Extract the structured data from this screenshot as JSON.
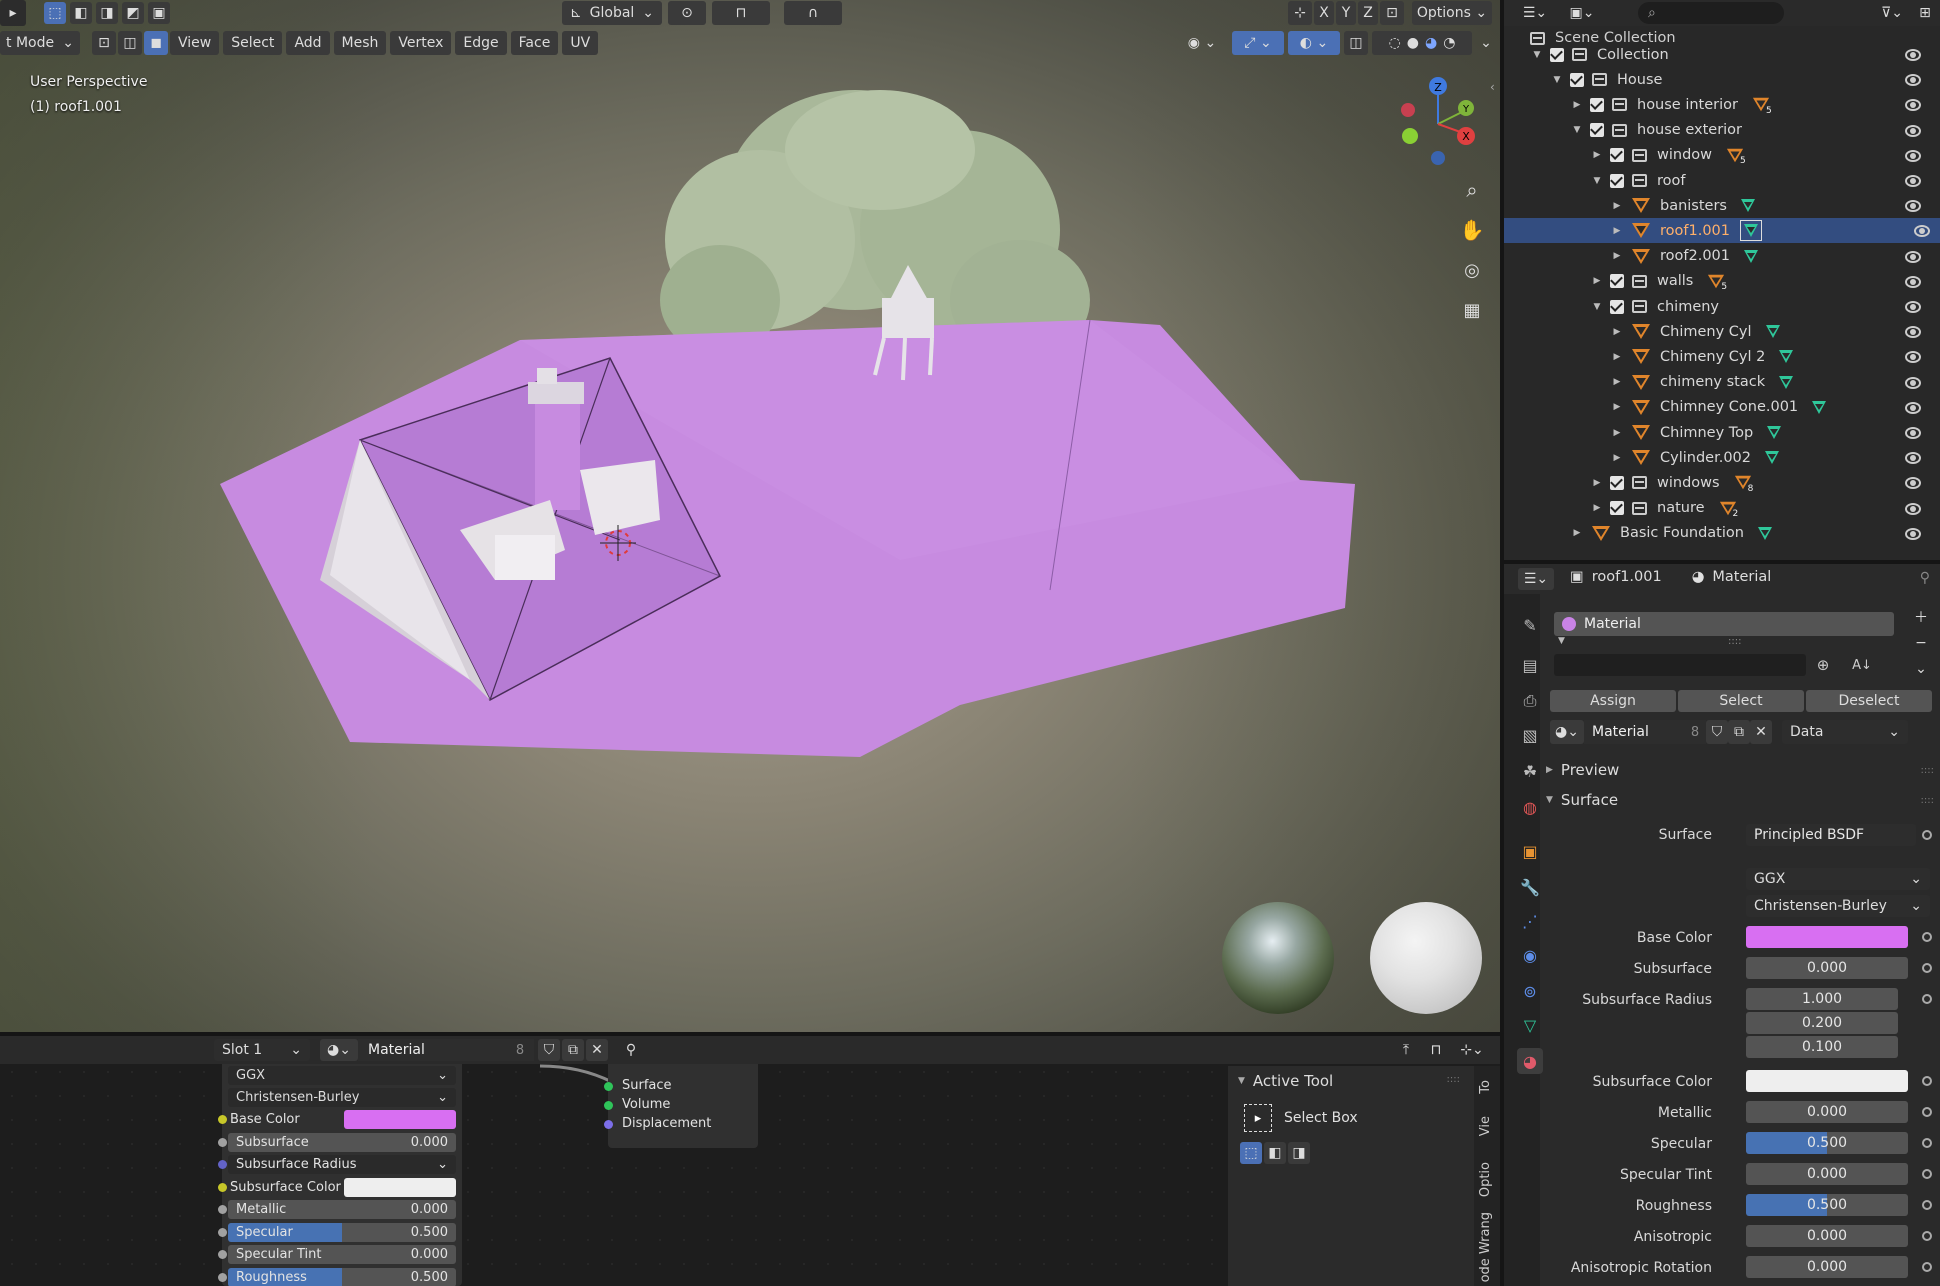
{
  "viewport": {
    "mode_label": "t Mode",
    "menus": [
      "View",
      "Select",
      "Add",
      "Mesh",
      "Vertex",
      "Edge",
      "Face",
      "UV"
    ],
    "transform_orientation": "Global",
    "axis_labels": [
      "X",
      "Y",
      "Z"
    ],
    "options_label": "Options",
    "overlay_title": "User Perspective",
    "overlay_object": "(1) roof1.001",
    "gizmo_axes": {
      "z": "Z",
      "y": "Y",
      "x": "X"
    }
  },
  "outliner": {
    "root": "Scene Collection",
    "rows": [
      {
        "label": "Collection",
        "kind": "collection",
        "depth": 0,
        "expanded": true,
        "check": true
      },
      {
        "label": "House",
        "kind": "collection",
        "depth": 1,
        "expanded": true,
        "check": true
      },
      {
        "label": "house interior",
        "kind": "collection",
        "depth": 2,
        "expanded": false,
        "check": true,
        "badge": "5"
      },
      {
        "label": "house exterior",
        "kind": "collection",
        "depth": 2,
        "expanded": true,
        "check": true
      },
      {
        "label": "window",
        "kind": "collection",
        "depth": 3,
        "expanded": false,
        "check": true,
        "badge": "5"
      },
      {
        "label": "roof",
        "kind": "collection",
        "depth": 3,
        "expanded": true,
        "check": true
      },
      {
        "label": "banisters",
        "kind": "mesh",
        "depth": 4,
        "expanded": false
      },
      {
        "label": "roof1.001",
        "kind": "mesh",
        "depth": 4,
        "expanded": false,
        "selected": true
      },
      {
        "label": "roof2.001",
        "kind": "mesh",
        "depth": 4,
        "expanded": false
      },
      {
        "label": "walls",
        "kind": "collection",
        "depth": 3,
        "expanded": false,
        "check": true,
        "badge": "5"
      },
      {
        "label": "chimeny",
        "kind": "collection",
        "depth": 3,
        "expanded": true,
        "check": true
      },
      {
        "label": "Chimeny Cyl",
        "kind": "mesh",
        "depth": 4,
        "expanded": false
      },
      {
        "label": "Chimeny Cyl 2",
        "kind": "mesh",
        "depth": 4,
        "expanded": false
      },
      {
        "label": "chimeny stack",
        "kind": "mesh",
        "depth": 4,
        "expanded": false
      },
      {
        "label": "Chimney Cone.001",
        "kind": "mesh",
        "depth": 4,
        "expanded": false
      },
      {
        "label": "Chimney Top",
        "kind": "mesh",
        "depth": 4,
        "expanded": false
      },
      {
        "label": "Cylinder.002",
        "kind": "mesh",
        "depth": 4,
        "expanded": false
      },
      {
        "label": "windows",
        "kind": "collection",
        "depth": 3,
        "expanded": false,
        "check": true,
        "badge": "8"
      },
      {
        "label": "nature",
        "kind": "collection",
        "depth": 3,
        "expanded": false,
        "check": true,
        "badge": "2"
      },
      {
        "label": "Basic Foundation",
        "kind": "mesh",
        "depth": 2,
        "expanded": false
      }
    ]
  },
  "properties": {
    "breadcrumb_object": "roof1.001",
    "breadcrumb_tab": "Material",
    "slot_name": "Material",
    "assign": "Assign",
    "select": "Select",
    "deselect": "Deselect",
    "material_name": "Material",
    "users": "8",
    "link": "Data",
    "preview_label": "Preview",
    "surface_section": "Surface",
    "surface_label": "Surface",
    "surface_value": "Principled BSDF",
    "distribution": "GGX",
    "subsurface_method": "Christensen-Burley",
    "base_color_label": "Base Color",
    "base_color": "#d86ff2",
    "subsurface_label": "Subsurface",
    "subsurface_value": "0.000",
    "subsurface_radius_label": "Subsurface Radius",
    "radius": [
      "1.000",
      "0.200",
      "0.100"
    ],
    "subsurface_color_label": "Subsurface Color",
    "metallic_label": "Metallic",
    "metallic_value": "0.000",
    "specular_label": "Specular",
    "specular_value": "0.500",
    "specular_tint_label": "Specular Tint",
    "specular_tint_value": "0.000",
    "roughness_label": "Roughness",
    "roughness_value": "0.500",
    "anisotropic_label": "Anisotropic",
    "anisotropic_value": "0.000",
    "aniso_rot_label": "Anisotropic Rotation",
    "aniso_rot_value": "0.000"
  },
  "node_editor": {
    "slot": "Slot 1",
    "material": "Material",
    "users": "8",
    "distribution": "GGX",
    "method": "Christensen-Burley",
    "fields": [
      {
        "label": "Base Color",
        "value": "",
        "socket": "#c7c729",
        "kind": "color",
        "color": "#d86ff2"
      },
      {
        "label": "Subsurface",
        "value": "0.000",
        "socket": "#a1a1a1",
        "kind": "num"
      },
      {
        "label": "Subsurface Radius",
        "value": "",
        "socket": "#6363c7",
        "kind": "drop"
      },
      {
        "label": "Subsurface Color",
        "value": "",
        "socket": "#c7c729",
        "kind": "color",
        "color": "#eeeeee"
      },
      {
        "label": "Metallic",
        "value": "0.000",
        "socket": "#a1a1a1",
        "kind": "num"
      },
      {
        "label": "Specular",
        "value": "0.500",
        "socket": "#a1a1a1",
        "kind": "num",
        "fill": 0.5
      },
      {
        "label": "Specular Tint",
        "value": "0.000",
        "socket": "#a1a1a1",
        "kind": "num"
      },
      {
        "label": "Roughness",
        "value": "0.500",
        "socket": "#a1a1a1",
        "kind": "num",
        "fill": 0.5
      }
    ],
    "output_sockets": [
      "Surface",
      "Volume",
      "Displacement"
    ],
    "active_tool_title": "Active Tool",
    "active_tool_name": "Select Box",
    "side_tabs": [
      "To",
      "Vie",
      "Optio",
      "ode Wrang"
    ]
  }
}
